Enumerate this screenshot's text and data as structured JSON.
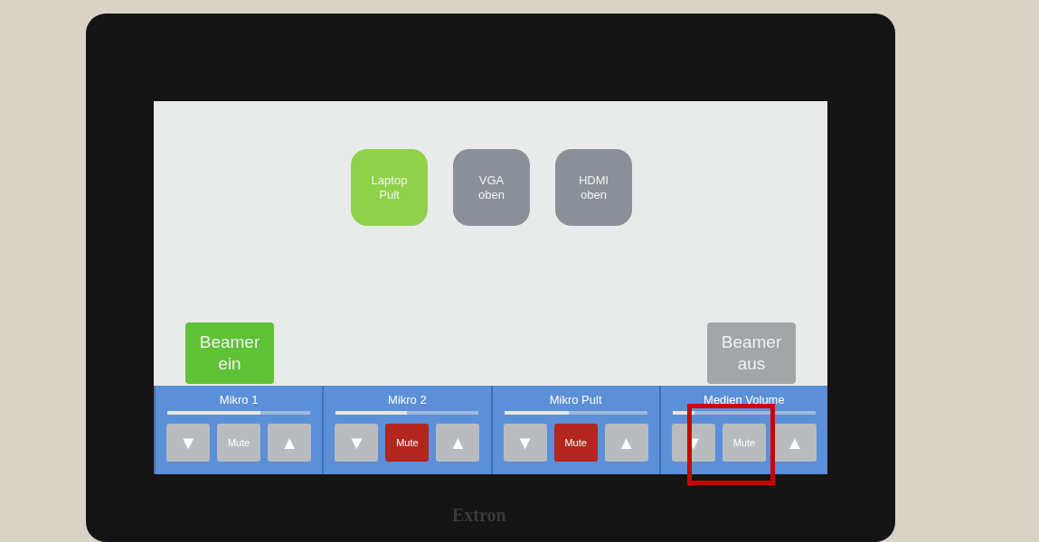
{
  "sources": [
    {
      "label": "Laptop\nPult",
      "selected": true
    },
    {
      "label": "VGA\noben",
      "selected": false
    },
    {
      "label": "HDMI\noben",
      "selected": false
    }
  ],
  "power": [
    {
      "label": "Beamer\nein",
      "selected": true
    },
    {
      "label": "Beamer\naus",
      "selected": false
    }
  ],
  "channels": [
    {
      "name": "Mikro 1",
      "level": 0.65,
      "down": "▼",
      "mute": "Mute",
      "muted": false,
      "up": "▲"
    },
    {
      "name": "Mikro 2",
      "level": 0.5,
      "down": "▼",
      "mute": "Mute",
      "muted": true,
      "up": "▲"
    },
    {
      "name": "Mikro Pult",
      "level": 0.45,
      "down": "▼",
      "mute": "Mute",
      "muted": true,
      "up": "▲"
    },
    {
      "name": "Medien Volume",
      "level": 0.15,
      "down": "▼",
      "mute": "Mute",
      "muted": false,
      "up": "▲"
    }
  ],
  "brand": "Extron"
}
